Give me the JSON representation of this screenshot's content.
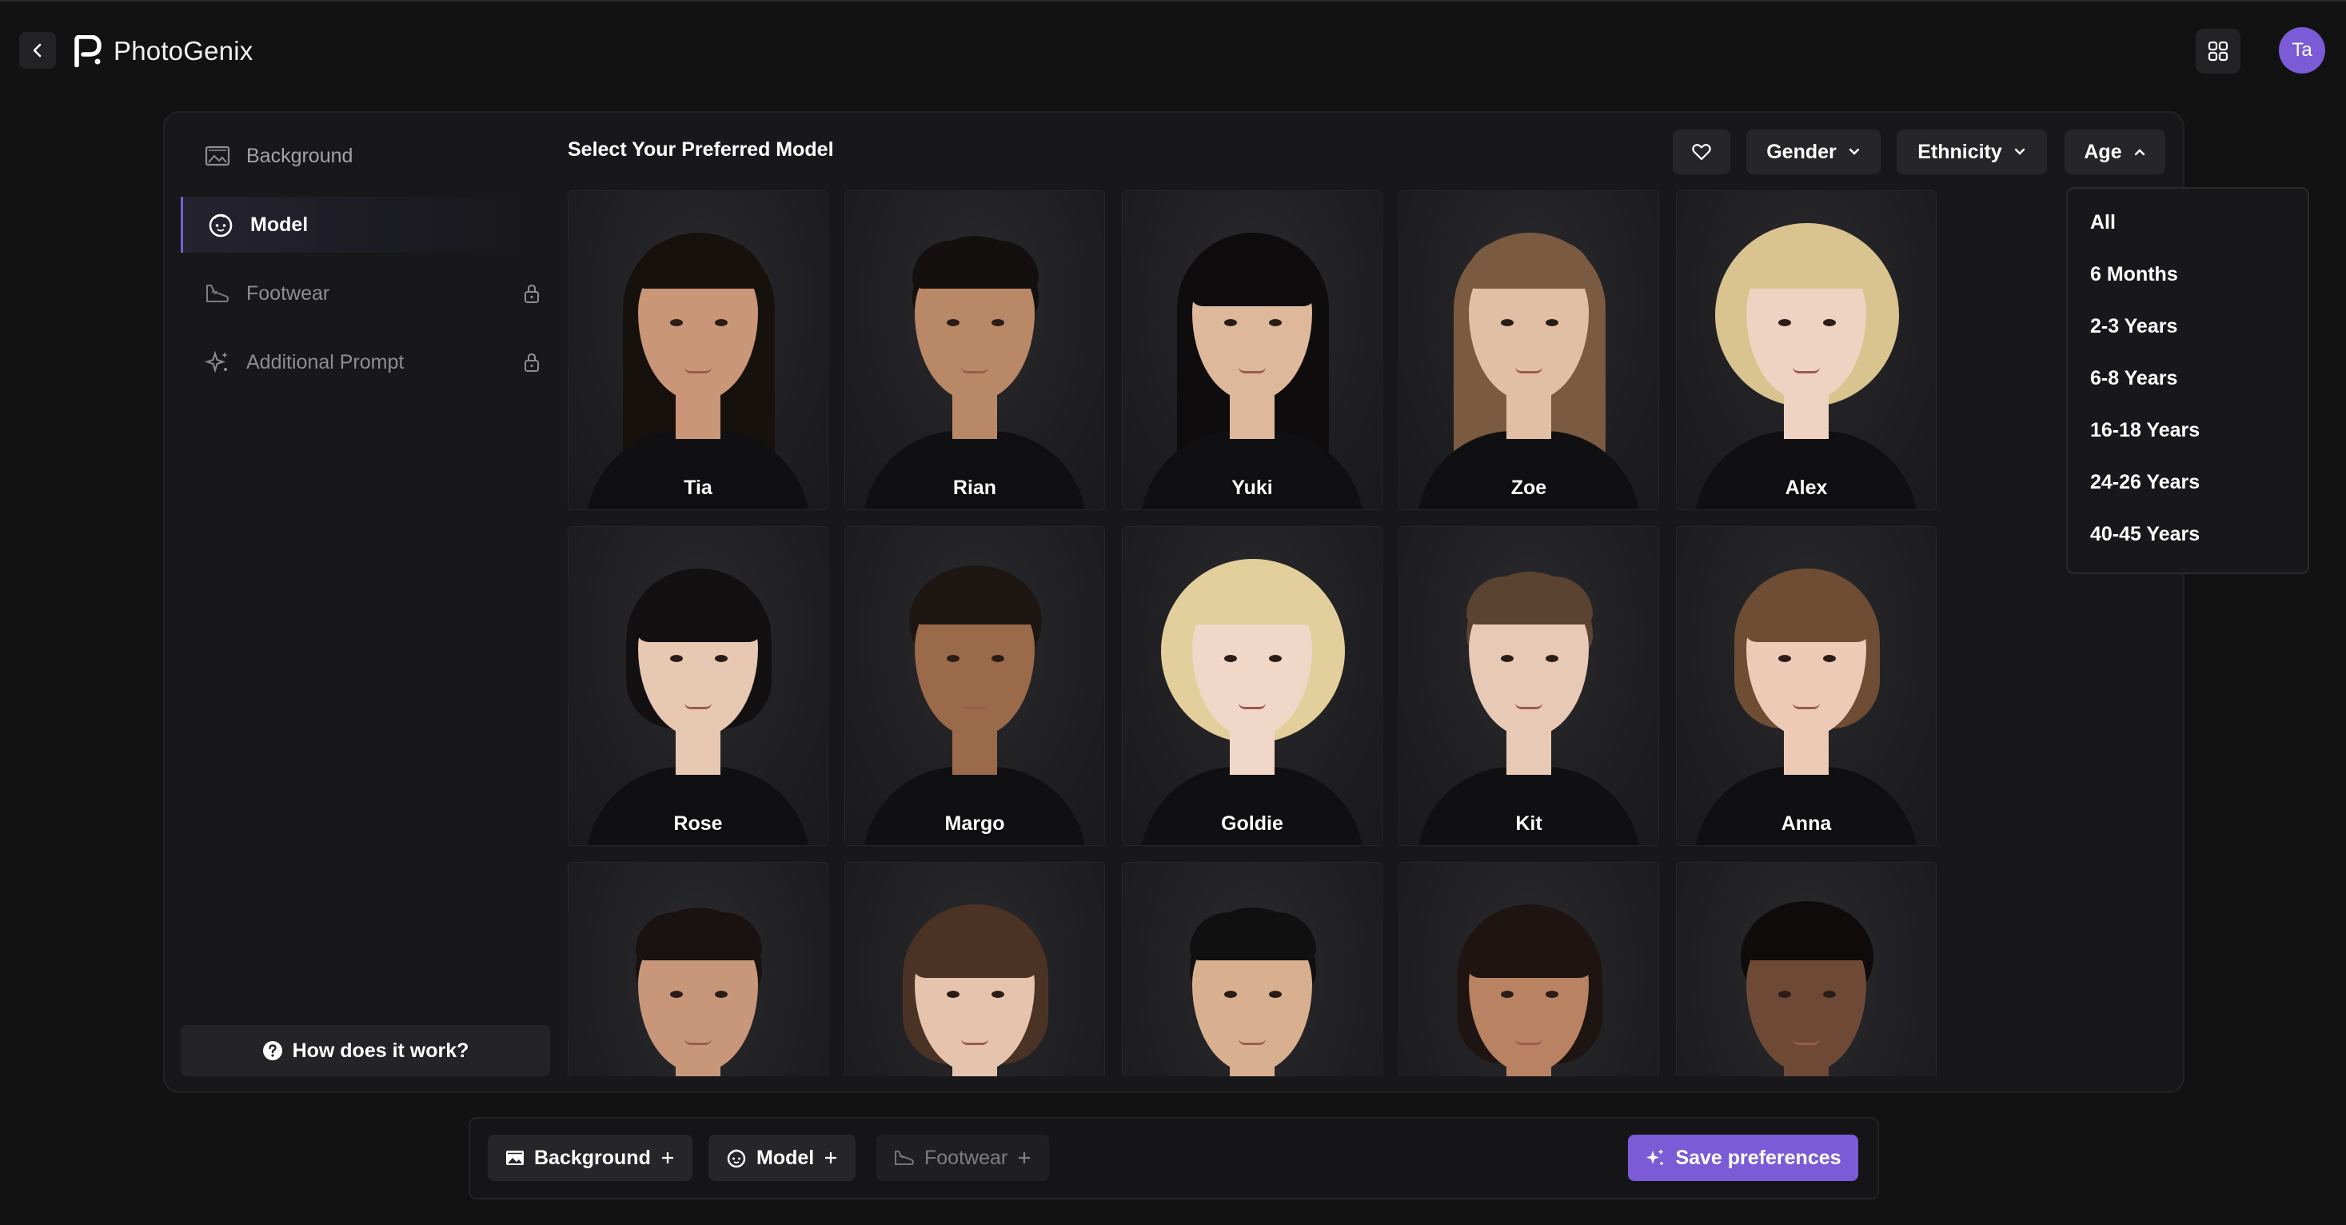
{
  "app": {
    "title": "PhotoGenix",
    "avatar_initials": "Ta",
    "accent_color": "#7b5cd6"
  },
  "sidebar": {
    "items": [
      {
        "label": "Background",
        "icon": "image-icon",
        "active": false,
        "locked": false
      },
      {
        "label": "Model",
        "icon": "face-icon",
        "active": true,
        "locked": false
      },
      {
        "label": "Footwear",
        "icon": "shoe-icon",
        "active": false,
        "locked": true
      },
      {
        "label": "Additional Prompt",
        "icon": "sparkle-icon",
        "active": false,
        "locked": true
      }
    ],
    "help_label": "How does it work?"
  },
  "content": {
    "title": "Select Your Preferred Model",
    "filters": {
      "gender": "Gender",
      "ethnicity": "Ethnicity",
      "age": "Age"
    }
  },
  "models": [
    {
      "name": "Tia"
    },
    {
      "name": "Rian"
    },
    {
      "name": "Yuki"
    },
    {
      "name": "Zoe"
    },
    {
      "name": "Alex"
    },
    {
      "name": "Rose"
    },
    {
      "name": "Margo"
    },
    {
      "name": "Goldie"
    },
    {
      "name": "Kit"
    },
    {
      "name": "Anna"
    },
    {
      "name": ""
    },
    {
      "name": ""
    },
    {
      "name": ""
    },
    {
      "name": ""
    },
    {
      "name": ""
    }
  ],
  "age_menu": {
    "options": [
      "All",
      "6 Months",
      "2-3 Years",
      "6-8 Years",
      "16-18 Years",
      "24-26 Years",
      "40-45 Years"
    ]
  },
  "bottom_bar": {
    "chips": [
      {
        "label": "Background",
        "icon": "image-icon",
        "enabled": true
      },
      {
        "label": "Model",
        "icon": "face-icon",
        "enabled": true
      },
      {
        "label": "Footwear",
        "icon": "shoe-icon",
        "enabled": false
      }
    ],
    "save_label": "Save preferences"
  }
}
